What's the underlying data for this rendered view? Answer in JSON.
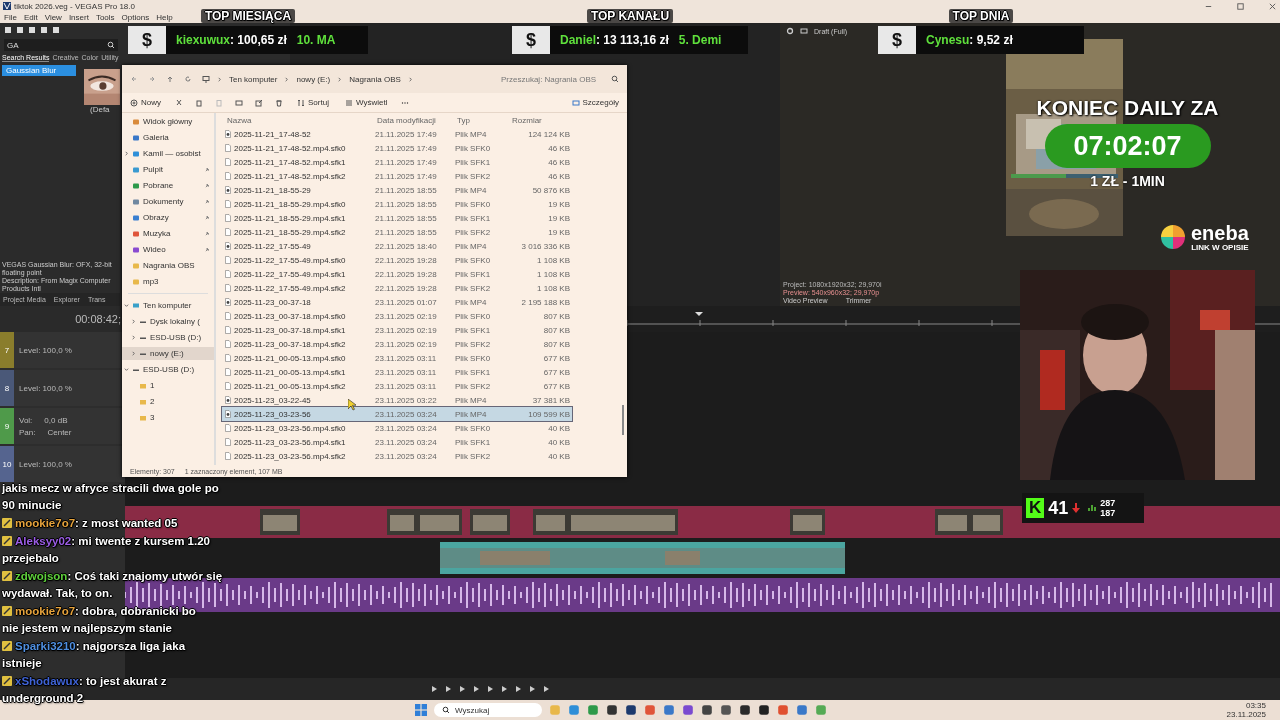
{
  "app": {
    "title": "tiktok 2026.veg - VEGAS Pro 18.0",
    "menu": [
      "File",
      "Edit",
      "View",
      "Insert",
      "Tools",
      "Options",
      "Help"
    ],
    "fx_search": "GA",
    "fx_tabs": [
      {
        "label": "Search Results",
        "selected": true
      },
      {
        "label": "Creative",
        "selected": false
      },
      {
        "label": "Color",
        "selected": false
      },
      {
        "label": "Utility",
        "selected": false
      }
    ],
    "fx_results": [
      {
        "label": "Gaussian Blur",
        "selected": true
      }
    ],
    "fx_preset": "(Defa",
    "fx_description": [
      "VEGAS Gaussian Blur: OFX, 32-bit floating point",
      "Description: From Magix Computer Products Intl"
    ],
    "dock_tabs": [
      "Project Media",
      "Explorer",
      "Trans"
    ],
    "timecode": "00:08:42;",
    "tracks": [
      {
        "number": "7",
        "kind": "video",
        "color": "#8a7d2c",
        "level_text": "Level: 100,0 %"
      },
      {
        "number": "8",
        "kind": "video",
        "color": "#4a5878",
        "level_text": "Level: 100,0 %"
      },
      {
        "number": "9",
        "kind": "audio",
        "color": "#4f9a4a",
        "vol_label": "Vol:",
        "vol": "0,0 dB",
        "pan_label": "Pan:",
        "pan": "Center"
      },
      {
        "number": "10",
        "kind": "video",
        "color": "#55648f",
        "level_text": "Level: 100,0 %"
      }
    ],
    "preview_quality": "Draft (Full)",
    "preview_info": [
      "Project: 1080x1920x32; 29,970i",
      "Preview: 540x960x32; 29,970p"
    ],
    "preview_tabs": [
      "Video Preview",
      "Trimmer"
    ]
  },
  "explorer": {
    "breadcrumbs": [
      "Ten komputer",
      "nowy (E:)",
      "Nagrania OBS"
    ],
    "search_placeholder": "Przeszukaj: Nagrania OBS",
    "toolbar": {
      "new": "Nowy",
      "sort": "Sortuj",
      "view": "Wyświetl",
      "details": "Szczegóły"
    },
    "nav_quick": [
      {
        "label": "Widok główny",
        "kind": "home",
        "pinned": false
      },
      {
        "label": "Galeria",
        "kind": "gallery",
        "pinned": false
      },
      {
        "label": "Kamil — osobist",
        "kind": "cloud",
        "pinned": false,
        "expanded": false
      },
      {
        "label": "Pulpit",
        "kind": "desktop",
        "pinned": true
      },
      {
        "label": "Pobrane",
        "kind": "download",
        "pinned": true
      },
      {
        "label": "Dokumenty",
        "kind": "docs",
        "pinned": true
      },
      {
        "label": "Obrazy",
        "kind": "pictures",
        "pinned": true
      },
      {
        "label": "Muzyka",
        "kind": "music",
        "pinned": true
      },
      {
        "label": "Wideo",
        "kind": "video",
        "pinned": true
      },
      {
        "label": "Nagrania OBS",
        "kind": "folder",
        "pinned": false
      },
      {
        "label": "mp3",
        "kind": "folder",
        "pinned": false
      }
    ],
    "nav_tree": [
      {
        "label": "Ten komputer",
        "kind": "pc",
        "expanded": true,
        "selected": false,
        "children": [
          {
            "label": "Dysk lokalny (",
            "kind": "disk",
            "expanded": false,
            "selected": false
          },
          {
            "label": "ESD-USB (D:)",
            "kind": "drive",
            "expanded": false,
            "selected": false
          },
          {
            "label": "nowy (E:)",
            "kind": "drive",
            "expanded": false,
            "selected": true
          }
        ]
      },
      {
        "label": "ESD-USB (D:)",
        "kind": "drive",
        "expanded": true,
        "selected": false,
        "children": [
          {
            "label": "1",
            "kind": "folder",
            "selected": false
          },
          {
            "label": "2",
            "kind": "folder",
            "selected": false
          },
          {
            "label": "3",
            "kind": "folder",
            "selected": false
          }
        ]
      }
    ],
    "columns": [
      "Nazwa",
      "Data modyfikacji",
      "Typ",
      "Rozmiar"
    ],
    "rows": [
      {
        "name": "2025-11-21_17-48-52",
        "date": "21.11.2025 17:49",
        "type": "Plik MP4",
        "size": "124 124 KB",
        "kind": "video",
        "selected": false
      },
      {
        "name": "2025-11-21_17-48-52.mp4.sfk0",
        "date": "21.11.2025 17:49",
        "type": "Plik SFK0",
        "size": "46 KB",
        "kind": "file",
        "selected": false
      },
      {
        "name": "2025-11-21_17-48-52.mp4.sfk1",
        "date": "21.11.2025 17:49",
        "type": "Plik SFK1",
        "size": "46 KB",
        "kind": "file",
        "selected": false
      },
      {
        "name": "2025-11-21_17-48-52.mp4.sfk2",
        "date": "21.11.2025 17:49",
        "type": "Plik SFK2",
        "size": "46 KB",
        "kind": "file",
        "selected": false
      },
      {
        "name": "2025-11-21_18-55-29",
        "date": "21.11.2025 18:55",
        "type": "Plik MP4",
        "size": "50 876 KB",
        "kind": "video",
        "selected": false
      },
      {
        "name": "2025-11-21_18-55-29.mp4.sfk0",
        "date": "21.11.2025 18:55",
        "type": "Plik SFK0",
        "size": "19 KB",
        "kind": "file",
        "selected": false
      },
      {
        "name": "2025-11-21_18-55-29.mp4.sfk1",
        "date": "21.11.2025 18:55",
        "type": "Plik SFK1",
        "size": "19 KB",
        "kind": "file",
        "selected": false
      },
      {
        "name": "2025-11-21_18-55-29.mp4.sfk2",
        "date": "21.11.2025 18:55",
        "type": "Plik SFK2",
        "size": "19 KB",
        "kind": "file",
        "selected": false
      },
      {
        "name": "2025-11-22_17-55-49",
        "date": "22.11.2025 18:40",
        "type": "Plik MP4",
        "size": "3 016 336 KB",
        "kind": "video",
        "selected": false
      },
      {
        "name": "2025-11-22_17-55-49.mp4.sfk0",
        "date": "22.11.2025 19:28",
        "type": "Plik SFK0",
        "size": "1 108 KB",
        "kind": "file",
        "selected": false
      },
      {
        "name": "2025-11-22_17-55-49.mp4.sfk1",
        "date": "22.11.2025 19:28",
        "type": "Plik SFK1",
        "size": "1 108 KB",
        "kind": "file",
        "selected": false
      },
      {
        "name": "2025-11-22_17-55-49.mp4.sfk2",
        "date": "22.11.2025 19:28",
        "type": "Plik SFK2",
        "size": "1 108 KB",
        "kind": "file",
        "selected": false
      },
      {
        "name": "2025-11-23_00-37-18",
        "date": "23.11.2025 01:07",
        "type": "Plik MP4",
        "size": "2 195 188 KB",
        "kind": "video",
        "selected": false
      },
      {
        "name": "2025-11-23_00-37-18.mp4.sfk0",
        "date": "23.11.2025 02:19",
        "type": "Plik SFK0",
        "size": "807 KB",
        "kind": "file",
        "selected": false
      },
      {
        "name": "2025-11-23_00-37-18.mp4.sfk1",
        "date": "23.11.2025 02:19",
        "type": "Plik SFK1",
        "size": "807 KB",
        "kind": "file",
        "selected": false
      },
      {
        "name": "2025-11-23_00-37-18.mp4.sfk2",
        "date": "23.11.2025 02:19",
        "type": "Plik SFK2",
        "size": "807 KB",
        "kind": "file",
        "selected": false
      },
      {
        "name": "2025-11-21_00-05-13.mp4.sfk0",
        "date": "23.11.2025 03:11",
        "type": "Plik SFK0",
        "size": "677 KB",
        "kind": "file",
        "selected": false
      },
      {
        "name": "2025-11-21_00-05-13.mp4.sfk1",
        "date": "23.11.2025 03:11",
        "type": "Plik SFK1",
        "size": "677 KB",
        "kind": "file",
        "selected": false
      },
      {
        "name": "2025-11-21_00-05-13.mp4.sfk2",
        "date": "23.11.2025 03:11",
        "type": "Plik SFK2",
        "size": "677 KB",
        "kind": "file",
        "selected": false
      },
      {
        "name": "2025-11-23_03-22-45",
        "date": "23.11.2025 03:22",
        "type": "Plik MP4",
        "size": "37 381 KB",
        "kind": "video",
        "selected": false
      },
      {
        "name": "2025-11-23_03-23-56",
        "date": "23.11.2025 03:24",
        "type": "Plik MP4",
        "size": "109 599 KB",
        "kind": "video",
        "selected": true
      },
      {
        "name": "2025-11-23_03-23-56.mp4.sfk0",
        "date": "23.11.2025 03:24",
        "type": "Plik SFK0",
        "size": "40 KB",
        "kind": "file",
        "selected": false
      },
      {
        "name": "2025-11-23_03-23-56.mp4.sfk1",
        "date": "23.11.2025 03:24",
        "type": "Plik SFK1",
        "size": "40 KB",
        "kind": "file",
        "selected": false
      },
      {
        "name": "2025-11-23_03-23-56.mp4.sfk2",
        "date": "23.11.2025 03:24",
        "type": "Plik SFK2",
        "size": "40 KB",
        "kind": "file",
        "selected": false
      }
    ],
    "status_count": "Elementy: 307",
    "status_selection": "1 zaznaczony element, 107 MB"
  },
  "donations": [
    {
      "title": "TOP MIESIĄCA",
      "sign": "$",
      "name": "kiexuwux",
      "amount": ": 100,65 zł",
      "extra": "10. MA"
    },
    {
      "title": "TOP KANAŁU",
      "sign": "$",
      "name": "Daniel",
      "amount": ": 13 113,16 zł",
      "extra": "5. Demi"
    },
    {
      "title": "TOP DNIA",
      "sign": "$",
      "name": "Cynesu",
      "amount": ": 9,52 zł"
    }
  ],
  "timer": {
    "heading": "KONIEC DAILY ZA",
    "time": "07:02:07",
    "rate": "1 ZŁ - 1MIN"
  },
  "sponsor": {
    "name": "eneba",
    "tagline": "LINK W OPISIE"
  },
  "kick": {
    "letter": "K",
    "viewers": "41",
    "stat_1": "287",
    "stat_2": "187"
  },
  "chat": [
    {
      "lines": [
        "jakis mecz w afryce stracili dwa gole po",
        "90 minucie"
      ]
    },
    {
      "user": "mookie7o7",
      "color": "#e6a33c",
      "lines": [
        ": z most wanted 05"
      ]
    },
    {
      "user": "Aleksyy02",
      "color": "#9b5de5",
      "lines": [
        ": mi twente z kursem 1.20",
        "przejebalo"
      ]
    },
    {
      "user": "zdwojson",
      "color": "#5fd03c",
      "lines": [
        ": Coś taki znajomy utwór się",
        "wydawał. Tak, to on."
      ]
    },
    {
      "user": "mookie7o7",
      "color": "#e6a33c",
      "lines": [
        ": dobra, dobranicki bo",
        "nie jestem w najlepszym stanie"
      ]
    },
    {
      "user": "Sparki3210",
      "color": "#4f8fe0",
      "lines": [
        ": najgorsza liga jaka",
        "istnieje"
      ]
    },
    {
      "user": "xShodawux",
      "color": "#3f63d6",
      "lines": [
        ": to jest akurat z",
        "underground 2"
      ]
    }
  ],
  "taskbar": {
    "search": "Wyszukaj",
    "time": "03:35",
    "date": "23.11.2025"
  }
}
